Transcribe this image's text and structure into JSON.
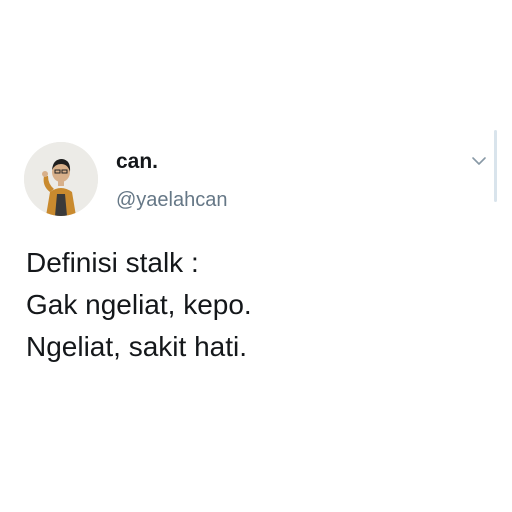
{
  "tweet": {
    "author": {
      "display_name": "can.",
      "handle": "@yaelahcan",
      "avatar_icon": "avatar-photo"
    },
    "menu_icon": "chevron-down-icon",
    "text_lines": [
      "Definisi stalk :",
      "Gak ngeliat, kepo.",
      "Ngeliat, sakit hati."
    ]
  },
  "colors": {
    "background": "#ffffff",
    "text_primary": "#14171a",
    "text_secondary": "#657786",
    "scrollbar": "#d9e4ec"
  }
}
